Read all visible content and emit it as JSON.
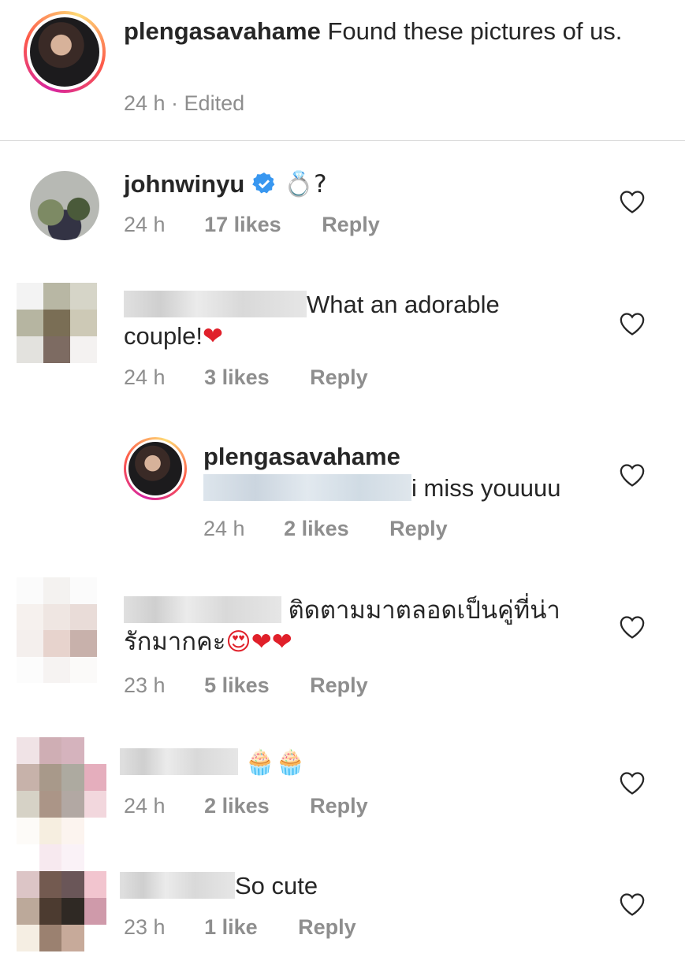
{
  "post": {
    "username": "plengasavahame",
    "caption": "Found these pictures of us.",
    "time": "24 h",
    "edited": "24 h · Edited"
  },
  "comments": [
    {
      "username": "johnwinyu",
      "verified": true,
      "text": "💍?",
      "time": "24 h",
      "likes": "17 likes",
      "reply": "Reply"
    },
    {
      "username": "",
      "text_line1": "What an adorable",
      "text_line2": "couple!",
      "emoji": "❤",
      "time": "24 h",
      "likes": "3 likes",
      "reply": "Reply"
    },
    {
      "username": "plengasavahame",
      "text": "i miss youuuu",
      "time": "24 h",
      "likes": "2 likes",
      "reply": "Reply"
    },
    {
      "username": "",
      "text_line1": "ติดตามมาตลอดเป็นคู่ที่น่า",
      "text_line2": "รักมากคะ",
      "emoji": "😍❤❤",
      "time": "23 h",
      "likes": "5 likes",
      "reply": "Reply"
    },
    {
      "username": "",
      "text": "🧁🧁",
      "time": "24 h",
      "likes": "2 likes",
      "reply": "Reply"
    },
    {
      "username": "",
      "text": "So cute",
      "time": "23 h",
      "likes": "1 like",
      "reply": "Reply"
    }
  ],
  "icons": {
    "like": "heart-outline-icon",
    "verified": "verified-badge-icon"
  },
  "colors": {
    "text": "#262626",
    "meta": "#8e8e8e",
    "verified": "#3897f0",
    "heart": "#e0202a"
  }
}
